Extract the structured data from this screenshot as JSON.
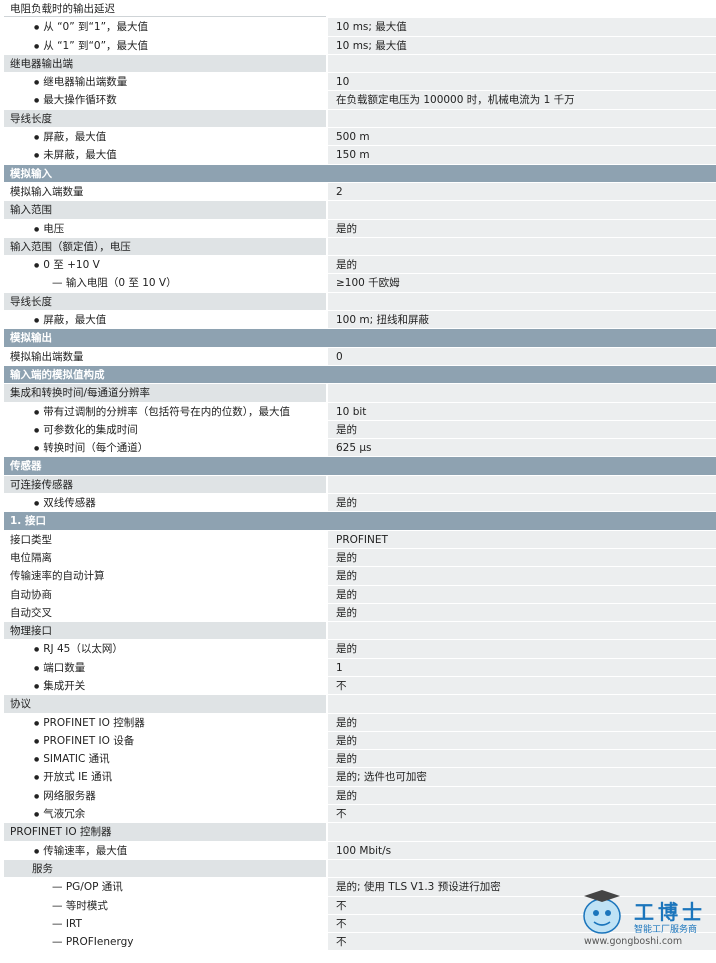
{
  "rows": [
    {
      "type": "top",
      "label": "电阻负载时的输出延迟",
      "value": ""
    },
    {
      "type": "item",
      "indent": 1,
      "bullet": true,
      "label": "从 “0” 到“1”，最大值",
      "value": "10 ms; 最大值"
    },
    {
      "type": "item",
      "indent": 1,
      "bullet": true,
      "label": "从 “1” 到“0”，最大值",
      "value": "10 ms; 最大值"
    },
    {
      "type": "sec",
      "label": "继电器输出端",
      "value": ""
    },
    {
      "type": "item",
      "indent": 1,
      "bullet": true,
      "label": "继电器输出端数量",
      "value": "10"
    },
    {
      "type": "item",
      "indent": 1,
      "bullet": true,
      "label": "最大操作循环数",
      "value": "在负载额定电压为 100000 时，机械电流为 1 千万"
    },
    {
      "type": "sec",
      "label": "导线长度",
      "value": ""
    },
    {
      "type": "item",
      "indent": 1,
      "bullet": true,
      "label": "屏蔽，最大值",
      "value": "500 m"
    },
    {
      "type": "item",
      "indent": 1,
      "bullet": true,
      "label": "未屏蔽，最大值",
      "value": "150 m"
    },
    {
      "type": "main",
      "label": "模拟输入",
      "value": ""
    },
    {
      "type": "item",
      "indent": 0,
      "bullet": false,
      "label": "模拟输入端数量",
      "value": "2"
    },
    {
      "type": "sec",
      "label": "输入范围",
      "value": ""
    },
    {
      "type": "item",
      "indent": 1,
      "bullet": true,
      "label": "电压",
      "value": "是的"
    },
    {
      "type": "sec",
      "label": "输入范围（额定值），电压",
      "value": ""
    },
    {
      "type": "item",
      "indent": 1,
      "bullet": true,
      "label": "0 至 +10 V",
      "value": "是的"
    },
    {
      "type": "item",
      "indent": 2,
      "dash": true,
      "label": "输入电阻（0 至 10 V）",
      "value": "≥100 千欧姆"
    },
    {
      "type": "sec",
      "label": "导线长度",
      "value": ""
    },
    {
      "type": "item",
      "indent": 1,
      "bullet": true,
      "label": "屏蔽，最大值",
      "value": "100 m; 扭线和屏蔽"
    },
    {
      "type": "main",
      "label": "模拟输出",
      "value": ""
    },
    {
      "type": "item",
      "indent": 0,
      "bullet": false,
      "label": "模拟输出端数量",
      "value": "0"
    },
    {
      "type": "main",
      "label": "输入端的模拟值构成",
      "value": ""
    },
    {
      "type": "sec",
      "label": "集成和转换时间/每通道分辨率",
      "value": ""
    },
    {
      "type": "item",
      "indent": 1,
      "bullet": true,
      "label": "带有过调制的分辨率（包括符号在内的位数），最大值",
      "value": "10 bit"
    },
    {
      "type": "item",
      "indent": 1,
      "bullet": true,
      "label": "可参数化的集成时间",
      "value": "是的"
    },
    {
      "type": "item",
      "indent": 1,
      "bullet": true,
      "label": "转换时间（每个通道）",
      "value": "625 µs"
    },
    {
      "type": "main",
      "label": "传感器",
      "value": ""
    },
    {
      "type": "sec",
      "label": "可连接传感器",
      "value": ""
    },
    {
      "type": "item",
      "indent": 1,
      "bullet": true,
      "label": "双线传感器",
      "value": "是的"
    },
    {
      "type": "main",
      "label": "1. 接口",
      "value": ""
    },
    {
      "type": "item",
      "indent": 0,
      "bullet": false,
      "label": "接口类型",
      "value": "PROFINET"
    },
    {
      "type": "item",
      "indent": 0,
      "bullet": false,
      "label": "电位隔离",
      "value": "是的"
    },
    {
      "type": "item",
      "indent": 0,
      "bullet": false,
      "label": "传输速率的自动计算",
      "value": "是的"
    },
    {
      "type": "item",
      "indent": 0,
      "bullet": false,
      "label": "自动协商",
      "value": "是的"
    },
    {
      "type": "item",
      "indent": 0,
      "bullet": false,
      "label": "自动交叉",
      "value": "是的"
    },
    {
      "type": "sec",
      "label": "物理接口",
      "value": ""
    },
    {
      "type": "item",
      "indent": 1,
      "bullet": true,
      "label": "RJ 45（以太网）",
      "value": "是的"
    },
    {
      "type": "item",
      "indent": 1,
      "bullet": true,
      "label": "端口数量",
      "value": "1"
    },
    {
      "type": "item",
      "indent": 1,
      "bullet": true,
      "label": "集成开关",
      "value": "不"
    },
    {
      "type": "sec",
      "label": "协议",
      "value": ""
    },
    {
      "type": "item",
      "indent": 1,
      "bullet": true,
      "label": "PROFINET IO 控制器",
      "value": "是的"
    },
    {
      "type": "item",
      "indent": 1,
      "bullet": true,
      "label": "PROFINET IO 设备",
      "value": "是的"
    },
    {
      "type": "item",
      "indent": 1,
      "bullet": true,
      "label": "SIMATIC 通讯",
      "value": "是的"
    },
    {
      "type": "item",
      "indent": 1,
      "bullet": true,
      "label": "开放式 IE 通讯",
      "value": "是的; 选件也可加密"
    },
    {
      "type": "item",
      "indent": 1,
      "bullet": true,
      "label": "网络服务器",
      "value": "是的"
    },
    {
      "type": "item",
      "indent": 1,
      "bullet": true,
      "label": "气液冗余",
      "value": "不"
    },
    {
      "type": "sec",
      "label": "PROFINET IO 控制器",
      "value": ""
    },
    {
      "type": "item",
      "indent": 1,
      "bullet": true,
      "label": "传输速率，最大值",
      "value": "100 Mbit/s"
    },
    {
      "type": "sec",
      "label": "服务",
      "value": "",
      "indentSec": true
    },
    {
      "type": "item",
      "indent": 2,
      "dash": true,
      "label": "PG/OP 通讯",
      "value": "是的; 使用 TLS V1.3 预设进行加密"
    },
    {
      "type": "item",
      "indent": 2,
      "dash": true,
      "label": "等时模式",
      "value": "不"
    },
    {
      "type": "item",
      "indent": 2,
      "dash": true,
      "label": "IRT",
      "value": "不"
    },
    {
      "type": "item",
      "indent": 2,
      "dash": true,
      "label": "PROFIenergy",
      "value": "不"
    }
  ],
  "watermark": {
    "brand": "工博士",
    "tagline": "智能工厂服务商",
    "url": "www.gongboshi.com"
  }
}
